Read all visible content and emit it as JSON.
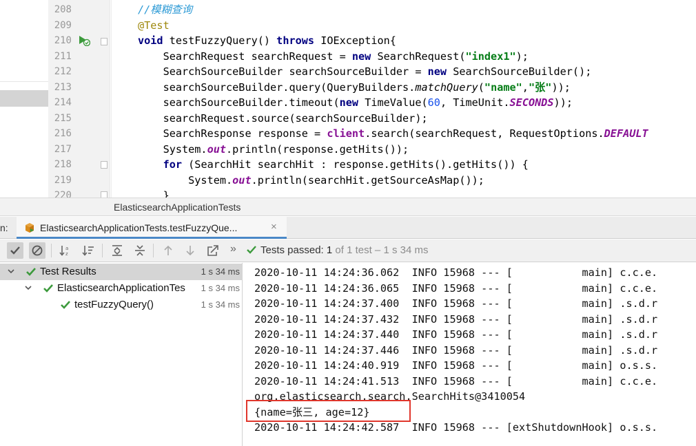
{
  "editor": {
    "line_numbers": [
      "208",
      "209",
      "210",
      "211",
      "212",
      "213",
      "214",
      "215",
      "216",
      "217",
      "218",
      "219",
      "220"
    ],
    "lines": [
      [
        {
          "t": "//模糊查询",
          "c": "cm"
        }
      ],
      [
        {
          "t": "@Test",
          "c": "an"
        }
      ],
      [
        {
          "t": "void",
          "c": "kw"
        },
        {
          "t": " testFuzzyQuery() "
        },
        {
          "t": "throws",
          "c": "kw"
        },
        {
          "t": " IOException{"
        }
      ],
      [
        {
          "t": "    SearchRequest searchRequest = "
        },
        {
          "t": "new",
          "c": "kw"
        },
        {
          "t": " SearchRequest("
        },
        {
          "t": "\"index1\"",
          "c": "str"
        },
        {
          "t": ");"
        }
      ],
      [
        {
          "t": "    SearchSourceBuilder searchSourceBuilder = "
        },
        {
          "t": "new",
          "c": "kw"
        },
        {
          "t": " SearchSourceBuilder();"
        }
      ],
      [
        {
          "t": "    searchSourceBuilder.query(QueryBuilders."
        },
        {
          "t": "matchQuery",
          "c": "it"
        },
        {
          "t": "("
        },
        {
          "t": "\"name\"",
          "c": "str"
        },
        {
          "t": ","
        },
        {
          "t": "\"张\"",
          "c": "str"
        },
        {
          "t": "));"
        }
      ],
      [
        {
          "t": "    searchSourceBuilder.timeout("
        },
        {
          "t": "new",
          "c": "kw"
        },
        {
          "t": " TimeValue("
        },
        {
          "t": "60",
          "c": "num"
        },
        {
          "t": ", TimeUnit."
        },
        {
          "t": "SECONDS",
          "c": "sf"
        },
        {
          "t": "));"
        }
      ],
      [
        {
          "t": "    searchRequest.source(searchSourceBuilder);"
        }
      ],
      [
        {
          "t": "    SearchResponse response = "
        },
        {
          "t": "client",
          "c": "fld"
        },
        {
          "t": ".search(searchRequest, RequestOptions."
        },
        {
          "t": "DEFAULT",
          "c": "sf"
        }
      ],
      [
        {
          "t": "    System."
        },
        {
          "t": "out",
          "c": "sti"
        },
        {
          "t": ".println(response.getHits());"
        }
      ],
      [
        {
          "t": "    "
        },
        {
          "t": "for",
          "c": "kw"
        },
        {
          "t": " (SearchHit searchHit : response.getHits().getHits()) {"
        }
      ],
      [
        {
          "t": "        System."
        },
        {
          "t": "out",
          "c": "sti"
        },
        {
          "t": ".println(searchHit.getSourceAsMap());"
        }
      ],
      [
        {
          "t": "    }"
        }
      ]
    ]
  },
  "breadcrumb": "ElasticsearchApplicationTests",
  "run_panel": {
    "label": "n:",
    "tab_title": "ElasticsearchApplicationTests.testFuzzyQue...",
    "close_glyph": "×"
  },
  "toolbar": {
    "more_glyph": "»",
    "status_prefix": "Tests passed: ",
    "status_count": "1",
    "status_suffix": " of 1 test – 1 s 34 ms"
  },
  "tree": [
    {
      "label": "Test Results",
      "time": "1 s 34 ms"
    },
    {
      "label": "ElasticsearchApplicationTes",
      "time": "1 s 34 ms"
    },
    {
      "label": "testFuzzyQuery()",
      "time": "1 s 34 ms"
    }
  ],
  "console": {
    "lines": [
      "2020-10-11 14:24:36.062  INFO 15968 --- [           main] c.c.e.",
      "2020-10-11 14:24:36.065  INFO 15968 --- [           main] c.c.e.",
      "2020-10-11 14:24:37.400  INFO 15968 --- [           main] .s.d.r",
      "2020-10-11 14:24:37.432  INFO 15968 --- [           main] .s.d.r",
      "2020-10-11 14:24:37.440  INFO 15968 --- [           main] .s.d.r",
      "2020-10-11 14:24:37.446  INFO 15968 --- [           main] .s.d.r",
      "2020-10-11 14:24:40.919  INFO 15968 --- [           main] o.s.s.",
      "2020-10-11 14:24:41.513  INFO 15968 --- [           main] c.c.e.",
      "org.elasticsearch.search.SearchHits@3410054",
      "{name=张三, age=12}",
      "2020-10-11 14:24:42.587  INFO 15968 --- [extShutdownHook] o.s.s."
    ]
  },
  "colors": {
    "pass_green": "#3c9a3c",
    "highlight_red": "#e0362c",
    "tab_underline": "#4a88c7"
  }
}
